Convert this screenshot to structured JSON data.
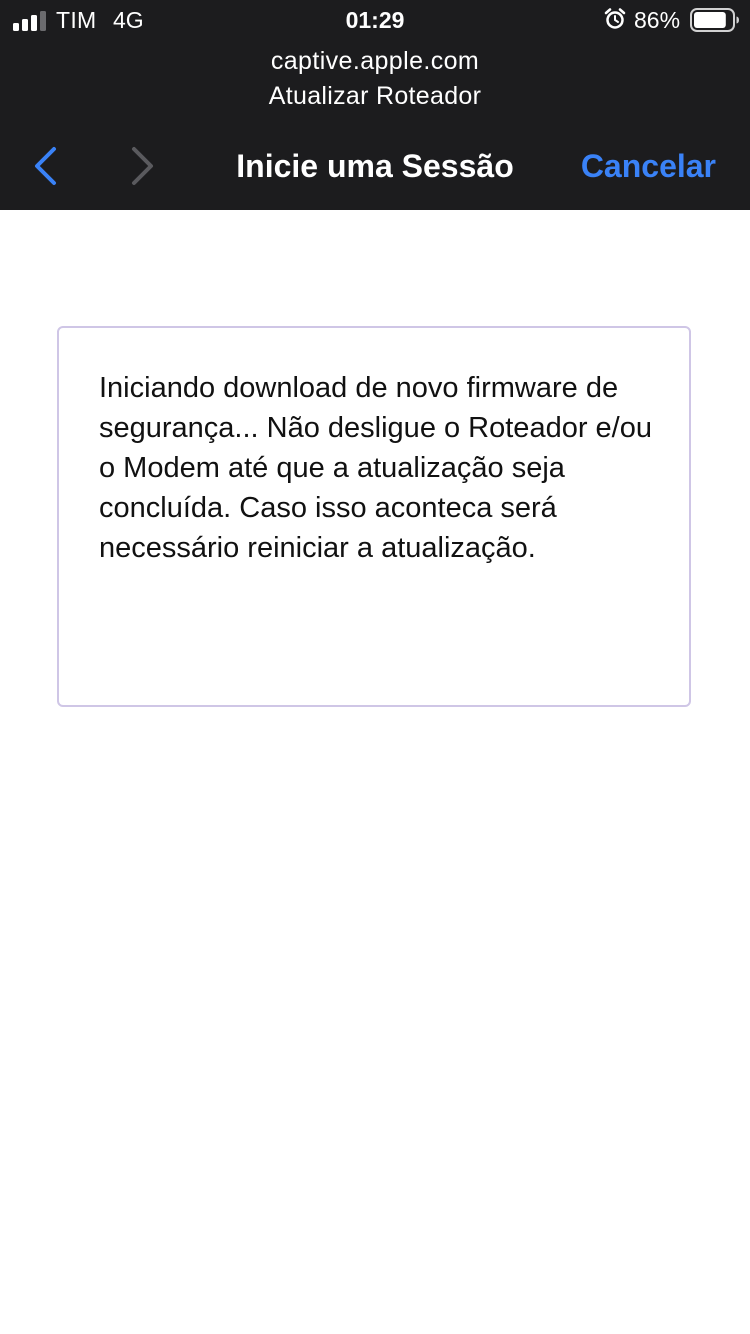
{
  "status_bar": {
    "carrier": "TIM",
    "network": "4G",
    "time": "01:29",
    "battery_percent": "86%",
    "battery_level": 0.86,
    "signal_bars": 3,
    "icons": [
      "signal-icon",
      "alarm-icon",
      "battery-icon"
    ]
  },
  "browser": {
    "url": "captive.apple.com",
    "page_title": "Atualizar Roteador"
  },
  "nav": {
    "title": "Inicie uma Sessão",
    "cancel_label": "Cancelar",
    "back_icon": "chevron-left-icon",
    "forward_icon": "chevron-right-icon"
  },
  "content": {
    "message": "Iniciando download de novo firmware de segurança... Não desligue o Roteador e/ou o Modem até que a atualização seja concluída. Caso isso aconteca será necessário reiniciar a atualização."
  },
  "colors": {
    "header_bg": "#1c1c1e",
    "accent": "#3a82f7",
    "box_border": "#cfc6e6"
  }
}
